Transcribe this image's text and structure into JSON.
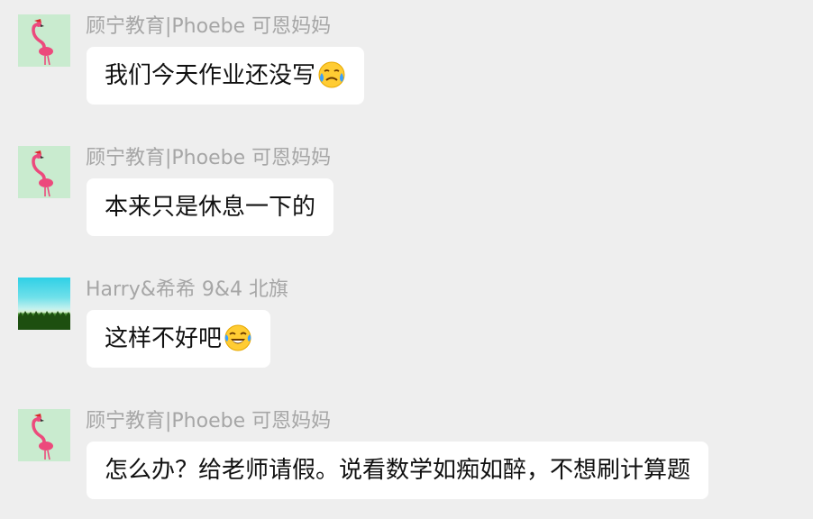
{
  "messages": [
    {
      "sender": "顾宁教育|Phoebe 可恩妈妈",
      "avatar": "flamingo-avatar",
      "text": "我们今天作业还没写",
      "emoji": "sad-crying-face-icon"
    },
    {
      "sender": "顾宁教育|Phoebe 可恩妈妈",
      "avatar": "flamingo-avatar",
      "text": "本来只是休息一下的"
    },
    {
      "sender": "Harry&希希 9&4 北旗",
      "avatar": "landscape-avatar",
      "text": "这样不好吧",
      "emoji": "laughing-tears-face-icon"
    },
    {
      "sender": "顾宁教育|Phoebe 可恩妈妈",
      "avatar": "flamingo-avatar",
      "text": "怎么办？给老师请假。说看数学如痴如醉，不想刷计算题"
    }
  ],
  "colors": {
    "background": "#eeeeee",
    "bubble": "#ffffff",
    "sender_text": "#a6a6a6",
    "message_text": "#111111",
    "flamingo_bg": "#c9ebcf",
    "flamingo": "#ec4a7c"
  }
}
